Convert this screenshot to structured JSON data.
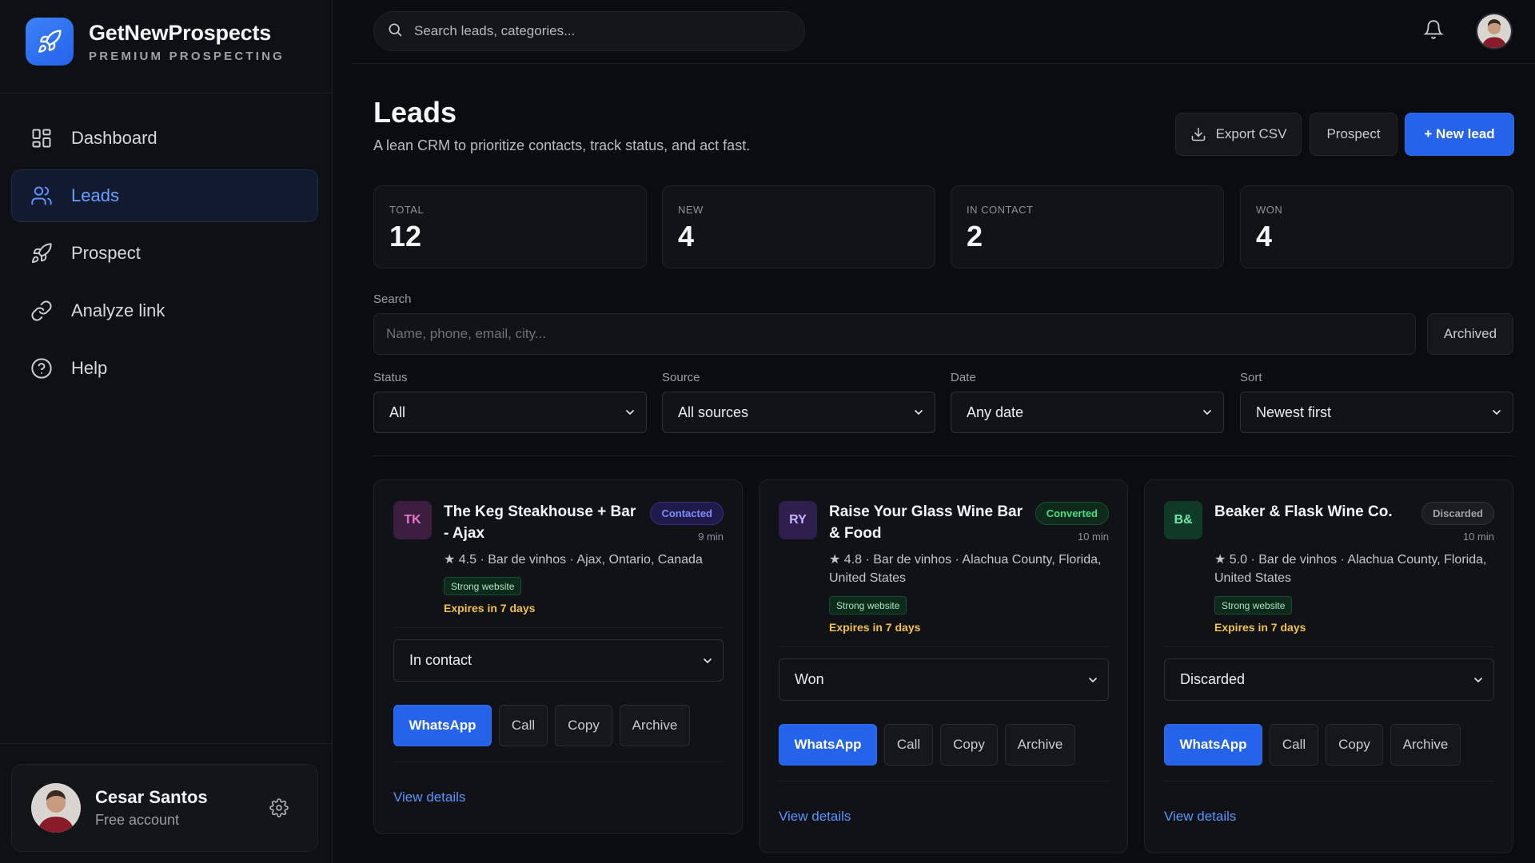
{
  "brand": {
    "name": "GetNewProspects",
    "tagline": "PREMIUM PROSPECTING"
  },
  "nav": [
    {
      "label": "Dashboard",
      "icon": "grid-icon",
      "active": false
    },
    {
      "label": "Leads",
      "icon": "users-icon",
      "active": true
    },
    {
      "label": "Prospect",
      "icon": "rocket-icon",
      "active": false
    },
    {
      "label": "Analyze link",
      "icon": "link-icon",
      "active": false
    },
    {
      "label": "Help",
      "icon": "help-circle-icon",
      "active": false
    }
  ],
  "user": {
    "name": "Cesar Santos",
    "plan": "Free account"
  },
  "topbar": {
    "search_placeholder": "Search leads, categories..."
  },
  "page": {
    "title": "Leads",
    "subtitle": "A lean CRM to prioritize contacts, track status, and act fast.",
    "export_label": "Export CSV",
    "prospect_label": "Prospect",
    "new_lead_label": "+ New lead"
  },
  "stats": [
    {
      "label": "TOTAL",
      "value": "12"
    },
    {
      "label": "NEW",
      "value": "4"
    },
    {
      "label": "IN CONTACT",
      "value": "2"
    },
    {
      "label": "WON",
      "value": "4"
    }
  ],
  "filters": {
    "search_label": "Search",
    "search_placeholder": "Name, phone, email, city...",
    "archived_label": "Archived",
    "status": {
      "label": "Status",
      "value": "All"
    },
    "source": {
      "label": "Source",
      "value": "All sources"
    },
    "date": {
      "label": "Date",
      "value": "Any date"
    },
    "sort": {
      "label": "Sort",
      "value": "Newest first"
    }
  },
  "leads": [
    {
      "initials": "TK",
      "name": "The Keg Steakhouse + Bar - Ajax",
      "badge": "Contacted",
      "time": "9 min",
      "meta": "★ 4.5 · Bar de vinhos · Ajax, Ontario, Canada",
      "tag": "Strong website",
      "expires": "Expires in 7 days",
      "status": "In contact",
      "actions": [
        "WhatsApp",
        "Call",
        "Copy",
        "Archive"
      ],
      "details": "View details"
    },
    {
      "initials": "RY",
      "name": "Raise Your Glass Wine Bar & Food",
      "badge": "Converted",
      "time": "10 min",
      "meta": "★ 4.8 · Bar de vinhos · Alachua County, Florida, United States",
      "tag": "Strong website",
      "expires": "Expires in 7 days",
      "status": "Won",
      "actions": [
        "WhatsApp",
        "Call",
        "Copy",
        "Archive"
      ],
      "details": "View details"
    },
    {
      "initials": "B&",
      "name": "Beaker & Flask Wine Co.",
      "badge": "Discarded",
      "time": "10 min",
      "meta": "★ 5.0 · Bar de vinhos · Alachua County, Florida, United States",
      "tag": "Strong website",
      "expires": "Expires in 7 days",
      "status": "Discarded",
      "actions": [
        "WhatsApp",
        "Call",
        "Copy",
        "Archive"
      ],
      "details": "View details"
    }
  ],
  "colors": {
    "accent": "#2563eb",
    "link": "#5b93ff",
    "expires": "#f0c14b",
    "contacted": "#818cf8",
    "converted": "#4ade80",
    "discarded": "#a1a1aa"
  }
}
